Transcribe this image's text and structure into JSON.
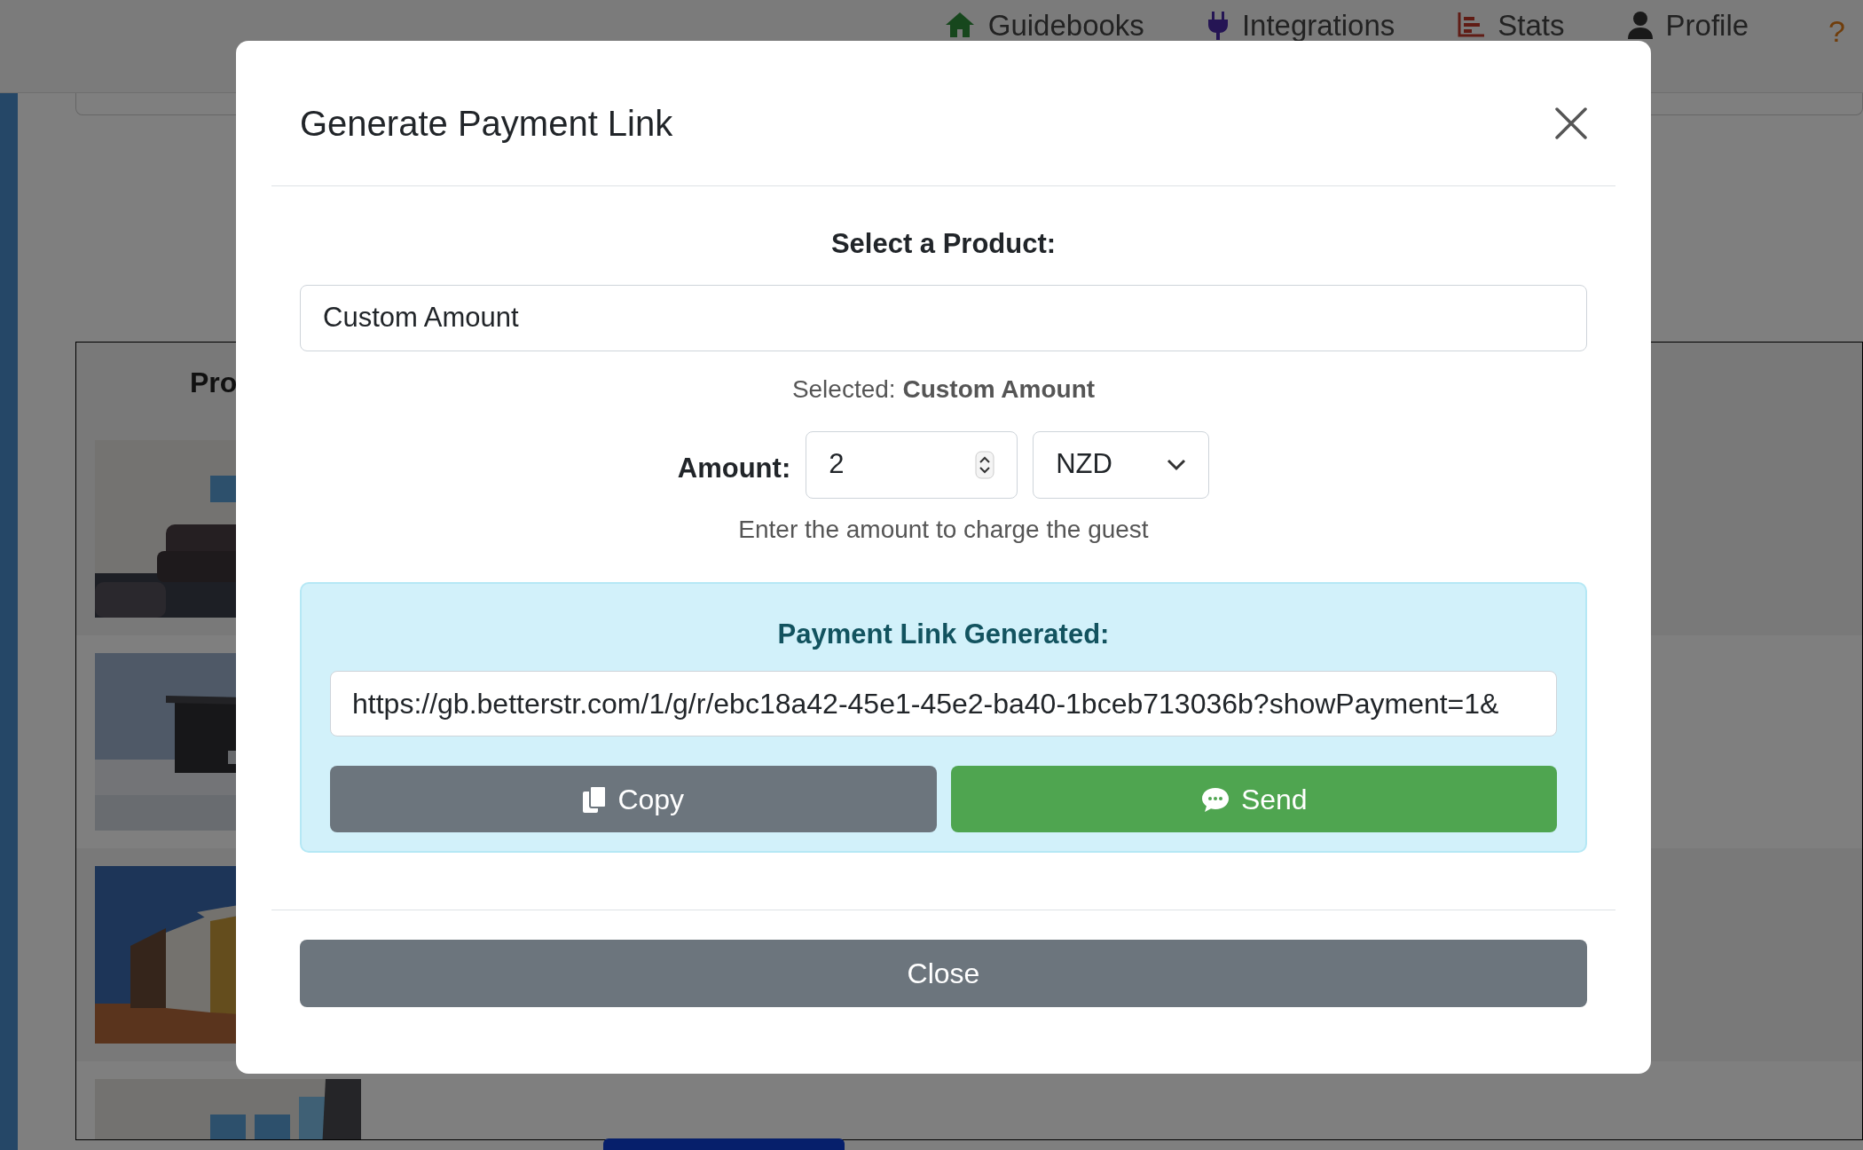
{
  "nav": [
    {
      "label": "Guidebooks",
      "kind": "home"
    },
    {
      "label": "Integrations",
      "kind": "plug"
    },
    {
      "label": "Stats",
      "kind": "stats"
    },
    {
      "label": "Profile",
      "kind": "person"
    }
  ],
  "help": "?",
  "table": {
    "header": "Pro"
  },
  "modal": {
    "title": "Generate Payment Link",
    "product_label": "Select a Product:",
    "product_value": "Custom Amount",
    "selected_text": "Selected: **Custom Amount**",
    "amount_label": "Amount:",
    "amount_value": "2",
    "currency": "NZD",
    "hint": "Enter the amount to charge the guest",
    "link_title": "Payment Link Generated:",
    "link_url": "https://gb.betterstr.com/1/g/r/ebc18a42-45e1-45e2-ba40-1bceb713036b?showPayment=1&",
    "copy_button": "Copy",
    "send_button": "Send",
    "close_button": "Close"
  }
}
